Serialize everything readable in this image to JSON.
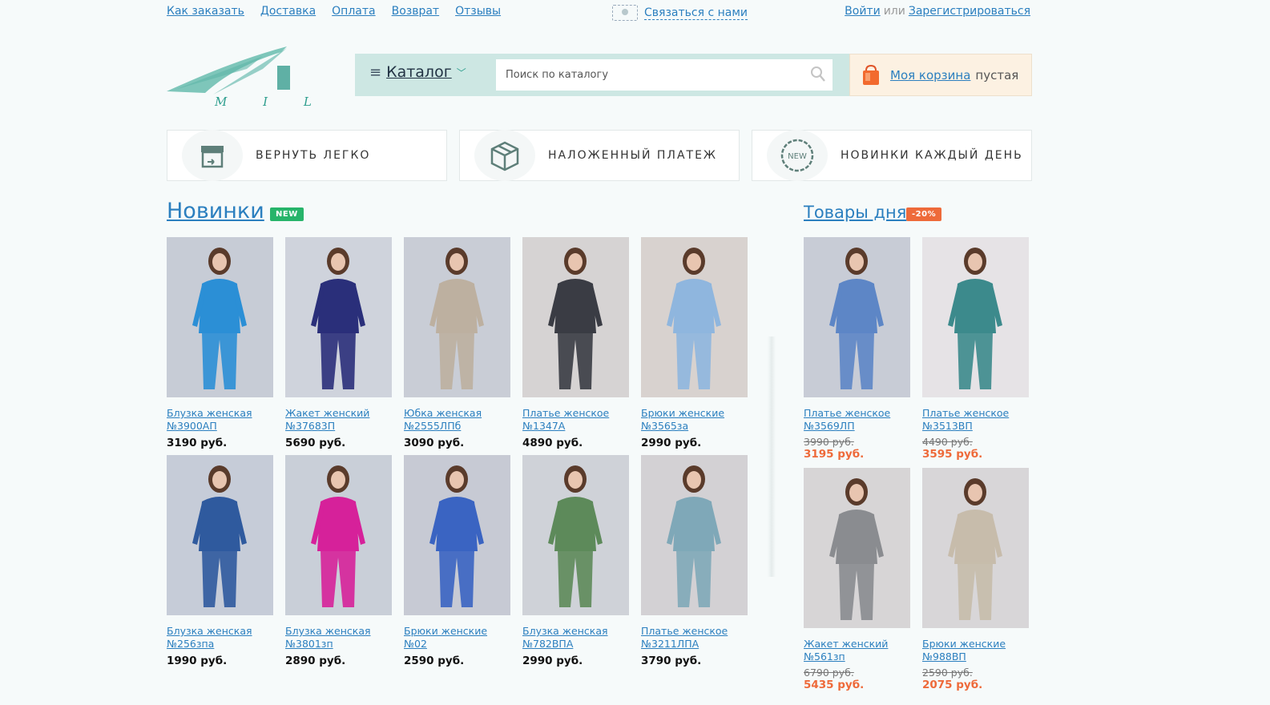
{
  "topnav": {
    "links": [
      "Как заказать",
      "Доставка",
      "Оплата",
      "Возврат",
      "Отзывы"
    ],
    "contact": "Связаться с нами",
    "login": "Войти",
    "or": "или",
    "register": "Зарегистрироваться"
  },
  "logo": {
    "text": "M I L A"
  },
  "catalog": {
    "label": "Каталог"
  },
  "search": {
    "placeholder": "Поиск по каталогу",
    "value": ""
  },
  "cart": {
    "link": "Моя корзина",
    "status": "пустая"
  },
  "features": [
    {
      "label": "ВЕРНУТЬ ЛЕГКО",
      "icon": "return-box-icon"
    },
    {
      "label": "НАЛОЖЕННЫЙ ПЛАТЕЖ",
      "icon": "package-icon"
    },
    {
      "label": "НОВИНКИ КАЖДЫЙ ДЕНЬ",
      "icon": "new-badge-icon",
      "icon_text": "NEW"
    }
  ],
  "new_section": {
    "title": "Новинки",
    "badge": "NEW"
  },
  "deals_section": {
    "title": "Товары дня",
    "badge": "-20%"
  },
  "new_products": [
    {
      "name": "Блузка женская №3900АП",
      "price": "3190 руб.",
      "color": "#2b8fd6",
      "bg": "#c7ccd6"
    },
    {
      "name": "Жакет женский №37683П",
      "price": "5690 руб.",
      "color": "#2a2f7a",
      "bg": "#cfd3dc"
    },
    {
      "name": "Юбка женская №2555ЛПб",
      "price": "3090 руб.",
      "color": "#bdb0a0",
      "bg": "#c9cdd6"
    },
    {
      "name": "Платье женское №1347А",
      "price": "4890 руб.",
      "color": "#3a3c44",
      "bg": "#d6d3d3"
    },
    {
      "name": "Брюки женские №3565за",
      "price": "2990 руб.",
      "color": "#8fb6de",
      "bg": "#d8d2cf"
    },
    {
      "name": "Блузка женская №256зпа",
      "price": "1990 руб.",
      "color": "#2f5a9e",
      "bg": "#c6ccd8"
    },
    {
      "name": "Блузка женская №3801зп",
      "price": "2890 руб.",
      "color": "#d6219a",
      "bg": "#c9cfd8"
    },
    {
      "name": "Брюки женские №02",
      "price": "2590 руб.",
      "color": "#3a64c2",
      "bg": "#c7cad4"
    },
    {
      "name": "Блузка женская №782ВПА",
      "price": "2990 руб.",
      "color": "#5d8a5a",
      "bg": "#cfd2d8"
    },
    {
      "name": "Платье женское №3211ЛПА",
      "price": "3790 руб.",
      "color": "#7fa8b8",
      "bg": "#d3d1d4"
    }
  ],
  "deal_products": [
    {
      "name": "Платье женское №3569ЛП",
      "old_price": "3990 руб.",
      "price": "3195 руб.",
      "color": "#5d86c6",
      "bg": "#c8ccd6"
    },
    {
      "name": "Платье женское №3513ВП",
      "old_price": "4490 руб.",
      "price": "3595 руб.",
      "color": "#3c8a8c",
      "bg": "#e6e3e6"
    },
    {
      "name": "Жакет женский №561зп",
      "old_price": "6790 руб.",
      "price": "5435 руб.",
      "color": "#8a8c90",
      "bg": "#d7d5d6"
    },
    {
      "name": "Брюки женские №988ВП",
      "old_price": "2590 руб.",
      "price": "2075 руб.",
      "color": "#c7bcab",
      "bg": "#d8d6d8"
    }
  ]
}
